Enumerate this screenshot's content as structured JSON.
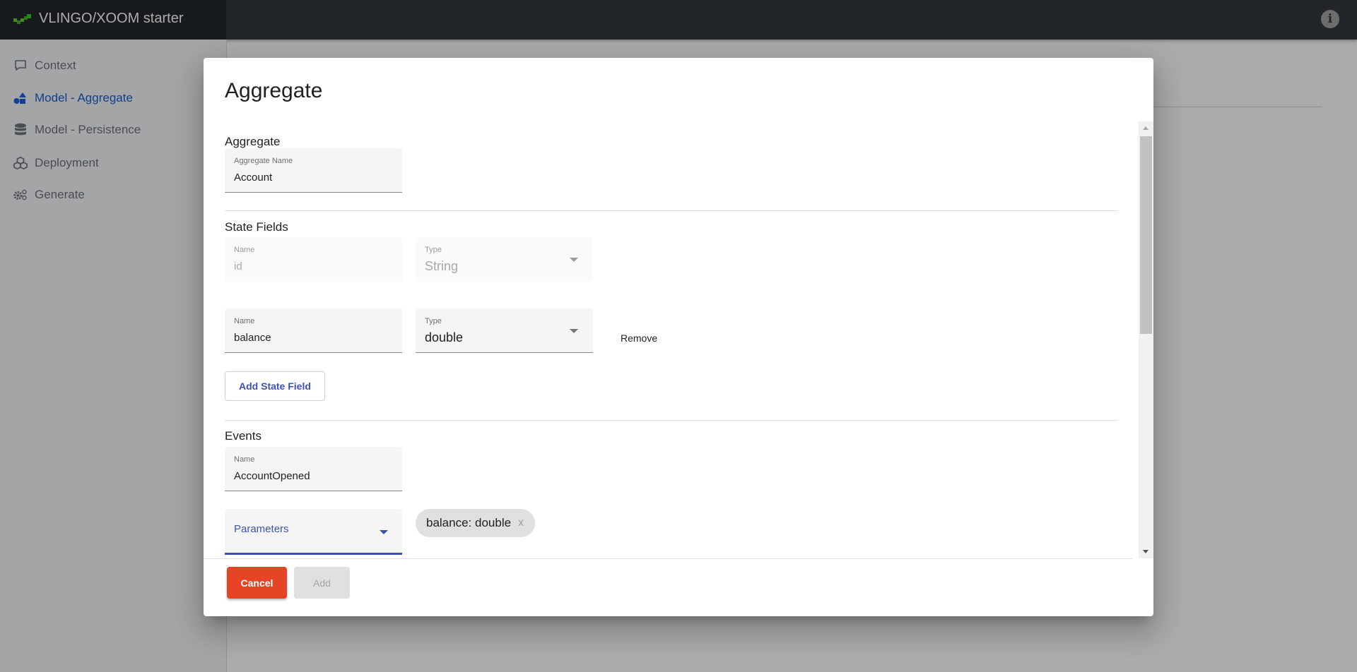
{
  "app": {
    "title": "VLINGO/XOOM starter",
    "logo_icon": "xoom-logo-icon",
    "info_icon": "info-icon",
    "colors": {
      "topbar": "#343a40",
      "brand_bg": "#23272b",
      "logo_green": "#6ac932",
      "active_nav": "#1b5ed4"
    }
  },
  "sidebar": {
    "items": [
      {
        "label": "Context",
        "icon": "comment-icon",
        "active": false
      },
      {
        "label": "Model - Aggregate",
        "icon": "shapes-icon",
        "active": true
      },
      {
        "label": "Model - Persistence",
        "icon": "database-icon",
        "active": false
      },
      {
        "label": "Deployment",
        "icon": "cubes-icon",
        "active": false
      },
      {
        "label": "Generate",
        "icon": "cogs-icon",
        "active": false
      }
    ]
  },
  "dialog": {
    "title": "Aggregate",
    "aggregate_section": {
      "label": "Aggregate",
      "name_field": {
        "label": "Aggregate Name",
        "value": "Account"
      }
    },
    "state_fields_section": {
      "label": "State Fields",
      "fields": [
        {
          "name_label": "Name",
          "name_value": "id",
          "type_label": "Type",
          "type_value": "String",
          "disabled": true
        },
        {
          "name_label": "Name",
          "name_value": "balance",
          "type_label": "Type",
          "type_value": "double",
          "disabled": false,
          "remove_label": "Remove"
        }
      ],
      "add_button": "Add State Field"
    },
    "events_section": {
      "label": "Events",
      "name_field": {
        "label": "Name",
        "value": "AccountOpened"
      },
      "parameters_field": {
        "label": "Parameters"
      },
      "chips": [
        {
          "label": "balance: double",
          "close": "x"
        }
      ]
    },
    "footer": {
      "cancel": "Cancel",
      "add": "Add",
      "cancel_color": "#e64525",
      "accent": "#3f51b5"
    }
  }
}
